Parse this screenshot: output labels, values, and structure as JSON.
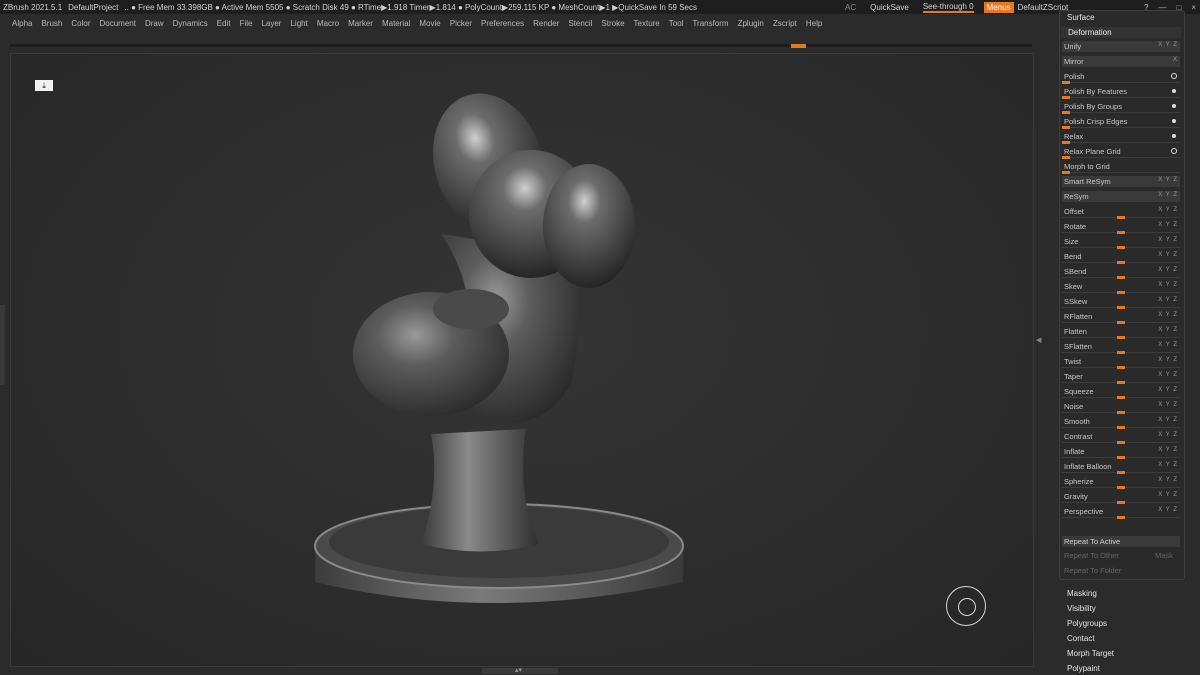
{
  "titlebar": {
    "app": "ZBrush 2021.5.1",
    "project": "DefaultProject",
    "stats": "..  ● Free Mem 33.398GB ● Active Mem 5505 ● Scratch Disk 49 ●  RTime▶1.918 Timer▶1.814 ● PolyCount▶259.115 KP  ● MeshCount▶1  ▶QuickSave In 59 Secs",
    "ac": "AC",
    "quicksave": "QuickSave",
    "see_through_label": "See-through",
    "see_through_value": "0",
    "menus": "Menus",
    "script": "DefaultZScript",
    "ctrl_help": "?",
    "ctrl_min": "—",
    "ctrl_restore": "□",
    "ctrl_close": "×"
  },
  "menubar": [
    "Alpha",
    "Brush",
    "Color",
    "Document",
    "Draw",
    "Dynamics",
    "Edit",
    "File",
    "Layer",
    "Light",
    "Macro",
    "Marker",
    "Material",
    "Movie",
    "Picker",
    "Preferences",
    "Render",
    "Stencil",
    "Stroke",
    "Texture",
    "Tool",
    "Transform",
    "Zplugin",
    "Zscript",
    "Help"
  ],
  "panel": {
    "surface": "Surface",
    "deformation": "Deformation",
    "rows": [
      {
        "label": "Unify",
        "boxed": true,
        "icon": "tiny",
        "tiny": "X Y Z"
      },
      {
        "label": "Mirror",
        "boxed": true,
        "icon": "tiny",
        "tiny": "X"
      },
      {
        "label": "Polish",
        "icon": "circle",
        "slider": 0
      },
      {
        "label": "Polish By Features",
        "icon": "dot",
        "slider": 0
      },
      {
        "label": "Polish By Groups",
        "icon": "dot",
        "slider": 0
      },
      {
        "label": "Polish Crisp Edges",
        "icon": "dot",
        "slider": 0
      },
      {
        "label": "Relax",
        "icon": "dot",
        "slider": 0
      },
      {
        "label": "Relax Plane Grid",
        "icon": "circle",
        "slider": 0
      },
      {
        "label": "Morph to Grid",
        "slider": 0
      },
      {
        "label": "Smart ReSym",
        "boxed": true,
        "icon": "tiny",
        "tiny": "X Y Z"
      },
      {
        "label": "ReSym",
        "boxed": true,
        "icon": "tiny",
        "tiny": "X Y Z"
      },
      {
        "label": "Offset",
        "icon": "tiny",
        "tiny": "X Y Z",
        "slider": 0.5
      },
      {
        "label": "Rotate",
        "icon": "tiny",
        "tiny": "X Y Z",
        "slider": 0.5
      },
      {
        "label": "Size",
        "icon": "tiny",
        "tiny": "X Y Z",
        "slider": 0.5
      },
      {
        "label": "Bend",
        "icon": "tiny",
        "tiny": "X Y Z",
        "slider": 0.5
      },
      {
        "label": "SBend",
        "icon": "tiny",
        "tiny": "X Y Z",
        "slider": 0.5
      },
      {
        "label": "Skew",
        "icon": "tiny",
        "tiny": "X Y Z",
        "slider": 0.5
      },
      {
        "label": "SSkew",
        "icon": "tiny",
        "tiny": "X Y Z",
        "slider": 0.5
      },
      {
        "label": "RFlatten",
        "icon": "tiny",
        "tiny": "X Y Z",
        "slider": 0.5
      },
      {
        "label": "Flatten",
        "icon": "tiny",
        "tiny": "X Y Z",
        "slider": 0.5
      },
      {
        "label": "SFlatten",
        "icon": "tiny",
        "tiny": "X Y Z",
        "slider": 0.5
      },
      {
        "label": "Twist",
        "icon": "tiny",
        "tiny": "X Y Z",
        "slider": 0.5
      },
      {
        "label": "Taper",
        "icon": "tiny",
        "tiny": "X Y Z",
        "slider": 0.5
      },
      {
        "label": "Squeeze",
        "icon": "tiny",
        "tiny": "X Y Z",
        "slider": 0.5
      },
      {
        "label": "Noise",
        "icon": "tiny",
        "tiny": "X Y Z",
        "slider": 0.5
      },
      {
        "label": "Smooth",
        "icon": "tiny",
        "tiny": "X Y Z",
        "slider": 0.5
      },
      {
        "label": "Contrast",
        "icon": "tiny",
        "tiny": "X Y Z",
        "slider": 0.5
      },
      {
        "label": "Inflate",
        "icon": "tiny",
        "tiny": "X Y Z",
        "slider": 0.5
      },
      {
        "label": "Inflate Balloon",
        "icon": "tiny",
        "tiny": "X Y Z",
        "slider": 0.5
      },
      {
        "label": "Spherize",
        "icon": "tiny",
        "tiny": "X Y Z",
        "slider": 0.5
      },
      {
        "label": "Gravity",
        "icon": "tiny",
        "tiny": "X Y Z",
        "slider": 0.5
      },
      {
        "label": "Perspective",
        "icon": "tiny",
        "tiny": "X Y Z",
        "slider": 0.5
      }
    ],
    "repeat_active": "Repeat To Active",
    "repeat_other": "Repeat To Other",
    "mask": "Mask",
    "repeat_folder": "Repeat To Folder",
    "subpalettes": [
      "Masking",
      "Visibility",
      "Polygroups",
      "Contact",
      "Morph Target",
      "Polypaint"
    ]
  },
  "accent_color": "#e87722"
}
